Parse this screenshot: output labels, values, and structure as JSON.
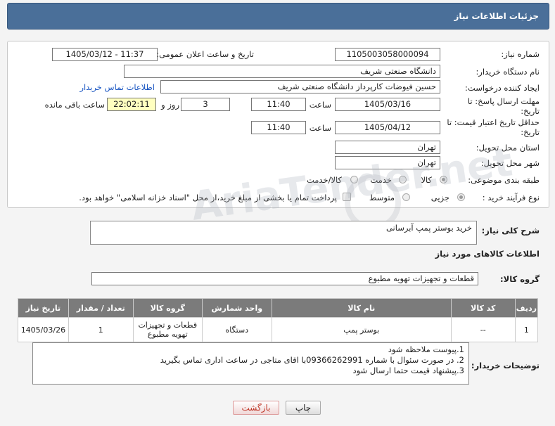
{
  "header": {
    "title": "جزئیات اطلاعات نیاز"
  },
  "form": {
    "need_number_label": "شماره نیاز:",
    "need_number": "1105003058000094",
    "announce_label": "تاریخ و ساعت اعلان عمومی:",
    "announce_value": "1405/03/12 - 11:37",
    "buyer_org_label": "نام دستگاه خریدار:",
    "buyer_org": "دانشگاه صنعتی شریف",
    "creator_label": "ایجاد کننده درخواست:",
    "creator": "حسین فیوضات کارپرداز دانشگاه صنعتی شریف",
    "contact_link": "اطلاعات تماس خریدار",
    "deadline_label": "مهلت ارسال پاسخ: تا تاریخ:",
    "deadline_date": "1405/03/16",
    "time_label": "ساعت",
    "deadline_time": "11:40",
    "days_value": "3",
    "days_label": "روز و",
    "remaining_time": "22:02:11",
    "remaining_label": "ساعت باقی مانده",
    "validity_label": "حداقل تاریخ اعتبار قیمت: تا تاریخ:",
    "validity_date": "1405/04/12",
    "validity_time": "11:40",
    "province_label": "استان محل تحویل:",
    "province": "تهران",
    "city_label": "شهر محل تحویل:",
    "city": "تهران",
    "category_label": "طبقه بندی موضوعی:",
    "category_options": [
      "کالا",
      "خدمت",
      "کالا/خدمت"
    ],
    "process_label": "نوع فرآیند خرید :",
    "process_options": [
      "جزیی",
      "متوسط"
    ],
    "payment_note": "پرداخت تمام یا بخشی از مبلغ خرید،از محل \"اسناد خزانه اسلامی\" خواهد بود."
  },
  "description": {
    "label": "شرح کلی نیاز:",
    "value": "خرید بوستر پمپ آبرسانی"
  },
  "goods": {
    "section_title": "اطلاعات کالاهای مورد نیاز",
    "group_label": "گروه کالا:",
    "group_value": "قطعات و تجهیزات تهویه مطبوع",
    "columns": [
      "ردیف",
      "کد کالا",
      "نام کالا",
      "واحد شمارش",
      "گروه کالا",
      "تعداد / مقدار",
      "تاریخ نیاز"
    ],
    "rows": [
      [
        "1",
        "--",
        "بوستر پمپ",
        "دستگاه",
        "قطعات و تجهیزات تهویه مطبوع",
        "1",
        "1405/03/26"
      ]
    ]
  },
  "buyer_notes": {
    "label": "توضیحات خریدار:",
    "lines": [
      "1.پیوست ملاحظه شود",
      "2. در صورت سئوال با شماره 09366262991با اقای متاجی در ساعت اداری تماس بگیرید",
      "3.پیشنهاد قیمت حتما ارسال شود"
    ]
  },
  "buttons": {
    "print": "چاپ",
    "back": "بازگشت"
  },
  "watermark": "AriaTender.net"
}
